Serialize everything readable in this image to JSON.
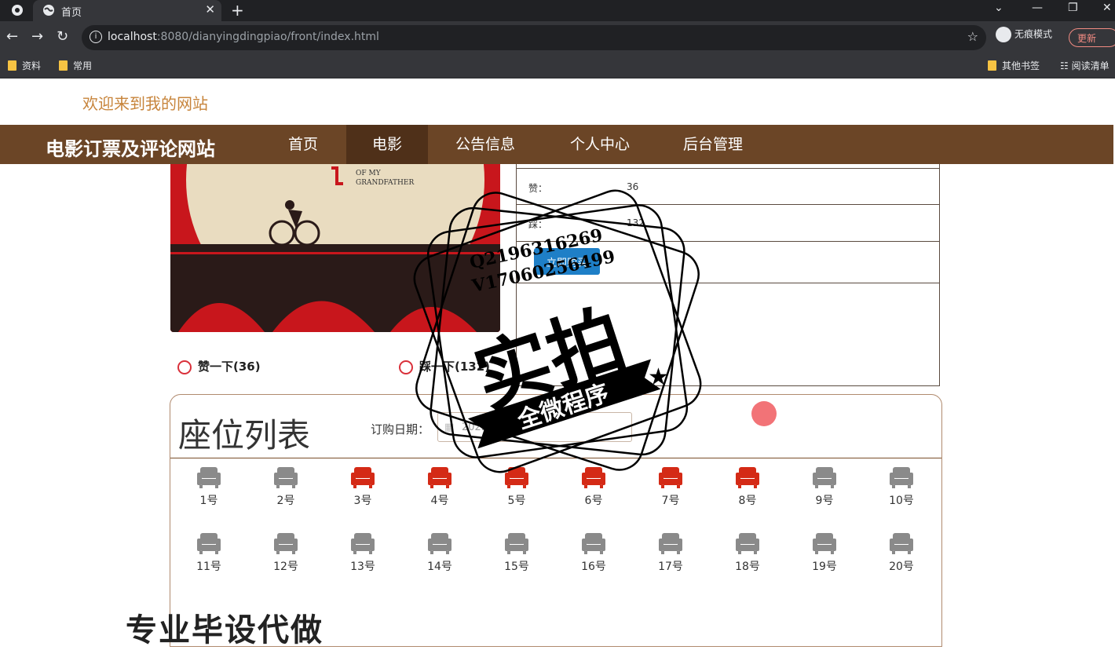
{
  "browser": {
    "tab_title": "首页",
    "url_host": "localhost",
    "url_rest": ":8080/dianyingdingpiao/front/index.html",
    "incognito_label": "无痕模式",
    "update_label": "更新",
    "bookmarks": [
      "资料",
      "常用"
    ],
    "bookmarks_right": [
      "其他书签",
      "阅读清单"
    ]
  },
  "site": {
    "welcome": "欢迎来到我的网站",
    "brand": "电影订票及评论网站",
    "menu": [
      "首页",
      "电影",
      "公告信息",
      "个人中心",
      "后台管理"
    ],
    "active_menu": "电影"
  },
  "poster": {
    "caption_line1": "OF MY",
    "caption_line2": "GRANDFATHER"
  },
  "movie_info": {
    "like_label": "赞：",
    "like_value": "36",
    "dislike_label": "踩：",
    "dislike_value": "132",
    "buy_button": "立即购买"
  },
  "votes": {
    "like": "赞一下(36)",
    "dislike": "踩一下(132)"
  },
  "seats": {
    "title": "座位列表",
    "date_label": "订购日期：",
    "date_value": "2022-02-1",
    "items": [
      {
        "label": "1号",
        "booked": false
      },
      {
        "label": "2号",
        "booked": false
      },
      {
        "label": "3号",
        "booked": true
      },
      {
        "label": "4号",
        "booked": true
      },
      {
        "label": "5号",
        "booked": true
      },
      {
        "label": "6号",
        "booked": true
      },
      {
        "label": "7号",
        "booked": true
      },
      {
        "label": "8号",
        "booked": true
      },
      {
        "label": "9号",
        "booked": false
      },
      {
        "label": "10号",
        "booked": false
      },
      {
        "label": "11号",
        "booked": false
      },
      {
        "label": "12号",
        "booked": false
      },
      {
        "label": "13号",
        "booked": false
      },
      {
        "label": "14号",
        "booked": false
      },
      {
        "label": "15号",
        "booked": false
      },
      {
        "label": "16号",
        "booked": false
      },
      {
        "label": "17号",
        "booked": false
      },
      {
        "label": "18号",
        "booked": false
      },
      {
        "label": "19号",
        "booked": false
      },
      {
        "label": "20号",
        "booked": false
      }
    ],
    "colors": {
      "available": "#8a8a8a",
      "booked": "#d42a16"
    }
  },
  "overlay": {
    "stamp_main": "实拍",
    "stamp_ribbon": "全微程序",
    "stamp_line1": "Q2196316269",
    "stamp_line2": "V17060256499",
    "bottom_watermark": "专业毕设代做"
  }
}
